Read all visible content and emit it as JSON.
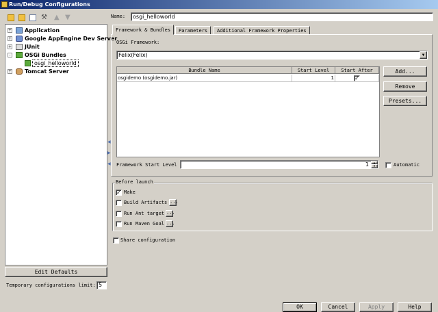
{
  "window": {
    "title": "Run/Debug Configurations"
  },
  "toolbar": {
    "icons": [
      "add-icon",
      "remove-icon",
      "copy-icon",
      "wrench-icon",
      "up-arrow-icon",
      "down-arrow-icon"
    ]
  },
  "tree": {
    "items": [
      {
        "label": "Application",
        "icon": "application-icon",
        "expander": "+"
      },
      {
        "label": "Google AppEngine Dev Server",
        "icon": "appengine-icon",
        "expander": "+"
      },
      {
        "label": "JUnit",
        "icon": "junit-icon",
        "expander": "+"
      },
      {
        "label": "OSGi Bundles",
        "icon": "osgi-icon",
        "expander": "-"
      },
      {
        "label": "Tomcat Server",
        "icon": "tomcat-icon",
        "expander": "+"
      }
    ],
    "child": {
      "label": "osgi_helloworld"
    }
  },
  "left": {
    "edit_defaults": "Edit Defaults",
    "temp_limit_label": "Temporary configurations limit:",
    "temp_limit_value": "5"
  },
  "name": {
    "label": "Name:",
    "value": "osgi_helloworld"
  },
  "tabs": [
    {
      "label": "Framework & Bundles",
      "active": true
    },
    {
      "label": "Parameters",
      "active": false
    },
    {
      "label": "Additional Framework Properties",
      "active": false
    }
  ],
  "framework": {
    "label": "OSGi Framework:",
    "selected": "Felix(Felix)"
  },
  "bundles": {
    "headers": {
      "name": "Bundle Name",
      "level": "Start Level",
      "after": "Start After"
    },
    "rows": [
      {
        "name": "osgidemo (osgidemo.jar)",
        "level": "1",
        "after": true
      }
    ]
  },
  "bundle_buttons": {
    "add": "Add...",
    "remove": "Remove",
    "presets": "Presets..."
  },
  "start_level": {
    "label": "Framework Start Level",
    "value": "1",
    "auto_label": "Automatic"
  },
  "before_launch": {
    "title": "Before launch",
    "items": [
      {
        "label": "Make",
        "checked": true,
        "has_dots": false
      },
      {
        "label": "Build Artifacts",
        "checked": false,
        "has_dots": true
      },
      {
        "label": "Run Ant target",
        "checked": false,
        "has_dots": true
      },
      {
        "label": "Run Maven Goal",
        "checked": false,
        "has_dots": true
      }
    ]
  },
  "share": {
    "label": "Share configuration"
  },
  "footer": {
    "ok": "OK",
    "cancel": "Cancel",
    "apply": "Apply",
    "help": "Help"
  }
}
